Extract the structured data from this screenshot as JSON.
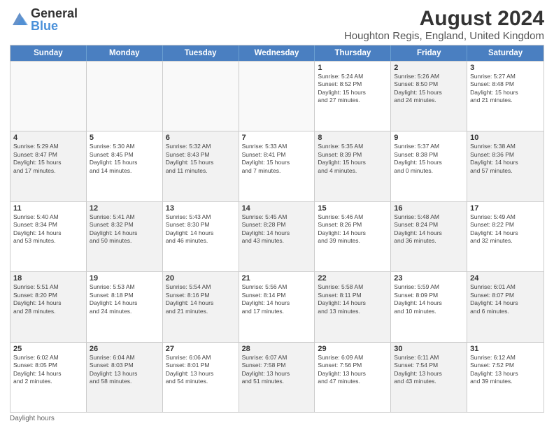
{
  "logo": {
    "general": "General",
    "blue": "Blue"
  },
  "title": {
    "month_year": "August 2024",
    "location": "Houghton Regis, England, United Kingdom"
  },
  "calendar": {
    "headers": [
      "Sunday",
      "Monday",
      "Tuesday",
      "Wednesday",
      "Thursday",
      "Friday",
      "Saturday"
    ],
    "footer": "Daylight hours",
    "weeks": [
      [
        {
          "day": "",
          "info": "",
          "empty": true
        },
        {
          "day": "",
          "info": "",
          "empty": true
        },
        {
          "day": "",
          "info": "",
          "empty": true
        },
        {
          "day": "",
          "info": "",
          "empty": true
        },
        {
          "day": "1",
          "info": "Sunrise: 5:24 AM\nSunset: 8:52 PM\nDaylight: 15 hours\nand 27 minutes."
        },
        {
          "day": "2",
          "info": "Sunrise: 5:26 AM\nSunset: 8:50 PM\nDaylight: 15 hours\nand 24 minutes."
        },
        {
          "day": "3",
          "info": "Sunrise: 5:27 AM\nSunset: 8:48 PM\nDaylight: 15 hours\nand 21 minutes."
        }
      ],
      [
        {
          "day": "4",
          "info": "Sunrise: 5:29 AM\nSunset: 8:47 PM\nDaylight: 15 hours\nand 17 minutes."
        },
        {
          "day": "5",
          "info": "Sunrise: 5:30 AM\nSunset: 8:45 PM\nDaylight: 15 hours\nand 14 minutes."
        },
        {
          "day": "6",
          "info": "Sunrise: 5:32 AM\nSunset: 8:43 PM\nDaylight: 15 hours\nand 11 minutes."
        },
        {
          "day": "7",
          "info": "Sunrise: 5:33 AM\nSunset: 8:41 PM\nDaylight: 15 hours\nand 7 minutes."
        },
        {
          "day": "8",
          "info": "Sunrise: 5:35 AM\nSunset: 8:39 PM\nDaylight: 15 hours\nand 4 minutes."
        },
        {
          "day": "9",
          "info": "Sunrise: 5:37 AM\nSunset: 8:38 PM\nDaylight: 15 hours\nand 0 minutes."
        },
        {
          "day": "10",
          "info": "Sunrise: 5:38 AM\nSunset: 8:36 PM\nDaylight: 14 hours\nand 57 minutes."
        }
      ],
      [
        {
          "day": "11",
          "info": "Sunrise: 5:40 AM\nSunset: 8:34 PM\nDaylight: 14 hours\nand 53 minutes."
        },
        {
          "day": "12",
          "info": "Sunrise: 5:41 AM\nSunset: 8:32 PM\nDaylight: 14 hours\nand 50 minutes."
        },
        {
          "day": "13",
          "info": "Sunrise: 5:43 AM\nSunset: 8:30 PM\nDaylight: 14 hours\nand 46 minutes."
        },
        {
          "day": "14",
          "info": "Sunrise: 5:45 AM\nSunset: 8:28 PM\nDaylight: 14 hours\nand 43 minutes."
        },
        {
          "day": "15",
          "info": "Sunrise: 5:46 AM\nSunset: 8:26 PM\nDaylight: 14 hours\nand 39 minutes."
        },
        {
          "day": "16",
          "info": "Sunrise: 5:48 AM\nSunset: 8:24 PM\nDaylight: 14 hours\nand 36 minutes."
        },
        {
          "day": "17",
          "info": "Sunrise: 5:49 AM\nSunset: 8:22 PM\nDaylight: 14 hours\nand 32 minutes."
        }
      ],
      [
        {
          "day": "18",
          "info": "Sunrise: 5:51 AM\nSunset: 8:20 PM\nDaylight: 14 hours\nand 28 minutes."
        },
        {
          "day": "19",
          "info": "Sunrise: 5:53 AM\nSunset: 8:18 PM\nDaylight: 14 hours\nand 24 minutes."
        },
        {
          "day": "20",
          "info": "Sunrise: 5:54 AM\nSunset: 8:16 PM\nDaylight: 14 hours\nand 21 minutes."
        },
        {
          "day": "21",
          "info": "Sunrise: 5:56 AM\nSunset: 8:14 PM\nDaylight: 14 hours\nand 17 minutes."
        },
        {
          "day": "22",
          "info": "Sunrise: 5:58 AM\nSunset: 8:11 PM\nDaylight: 14 hours\nand 13 minutes."
        },
        {
          "day": "23",
          "info": "Sunrise: 5:59 AM\nSunset: 8:09 PM\nDaylight: 14 hours\nand 10 minutes."
        },
        {
          "day": "24",
          "info": "Sunrise: 6:01 AM\nSunset: 8:07 PM\nDaylight: 14 hours\nand 6 minutes."
        }
      ],
      [
        {
          "day": "25",
          "info": "Sunrise: 6:02 AM\nSunset: 8:05 PM\nDaylight: 14 hours\nand 2 minutes."
        },
        {
          "day": "26",
          "info": "Sunrise: 6:04 AM\nSunset: 8:03 PM\nDaylight: 13 hours\nand 58 minutes."
        },
        {
          "day": "27",
          "info": "Sunrise: 6:06 AM\nSunset: 8:01 PM\nDaylight: 13 hours\nand 54 minutes."
        },
        {
          "day": "28",
          "info": "Sunrise: 6:07 AM\nSunset: 7:58 PM\nDaylight: 13 hours\nand 51 minutes."
        },
        {
          "day": "29",
          "info": "Sunrise: 6:09 AM\nSunset: 7:56 PM\nDaylight: 13 hours\nand 47 minutes."
        },
        {
          "day": "30",
          "info": "Sunrise: 6:11 AM\nSunset: 7:54 PM\nDaylight: 13 hours\nand 43 minutes."
        },
        {
          "day": "31",
          "info": "Sunrise: 6:12 AM\nSunset: 7:52 PM\nDaylight: 13 hours\nand 39 minutes."
        }
      ]
    ]
  }
}
